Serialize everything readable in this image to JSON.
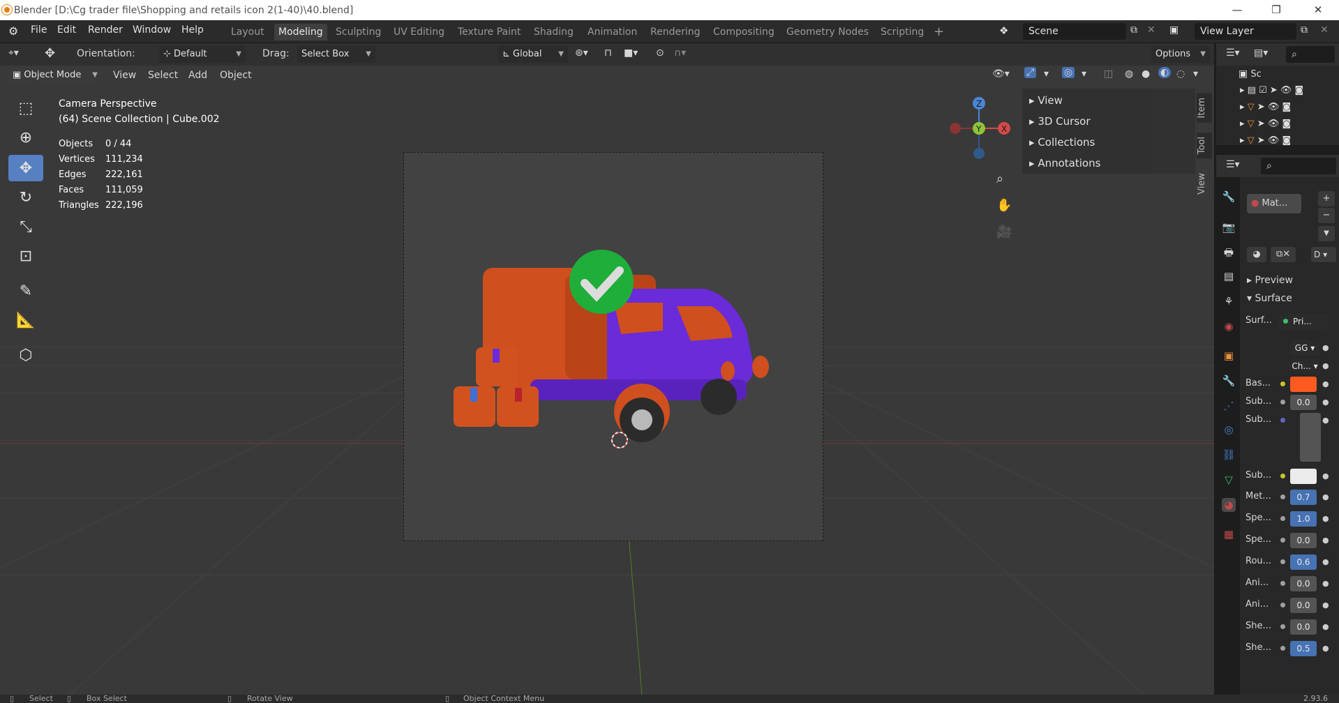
{
  "window": {
    "title": "Blender [D:\\Cg trader file\\Shopping and retails icon 2(1-40)\\40.blend]",
    "minimize": "—",
    "maximize": "❐",
    "close": "✕"
  },
  "menus": [
    "File",
    "Edit",
    "Render",
    "Window",
    "Help"
  ],
  "workspaces": [
    "Layout",
    "Modeling",
    "Sculpting",
    "UV Editing",
    "Texture Paint",
    "Shading",
    "Animation",
    "Rendering",
    "Compositing",
    "Geometry Nodes",
    "Scripting"
  ],
  "active_workspace": "Modeling",
  "scene": {
    "name": "Scene",
    "view_layer": "View Layer"
  },
  "header": {
    "orientation_label": "Orientation:",
    "orientation_value": "Default",
    "drag_label": "Drag:",
    "drag_value": "Select Box",
    "transform_value": "Global",
    "options": "Options"
  },
  "viewport_header": {
    "mode": "Object Mode",
    "view": "View",
    "select": "Select",
    "add": "Add",
    "object": "Object"
  },
  "overlay": {
    "camera": "Camera Perspective",
    "collection": "(64) Scene Collection | Cube.002"
  },
  "stats": [
    {
      "k": "Objects",
      "v": "0 / 44"
    },
    {
      "k": "Vertices",
      "v": "111,234"
    },
    {
      "k": "Edges",
      "v": "222,161"
    },
    {
      "k": "Faces",
      "v": "111,059"
    },
    {
      "k": "Triangles",
      "v": "222,196"
    }
  ],
  "npanel": [
    "View",
    "3D Cursor",
    "Collections",
    "Annotations"
  ],
  "ntabs": [
    "Item",
    "Tool",
    "View"
  ],
  "gizmo": {
    "z": "Z",
    "y": "Y",
    "x": "X"
  },
  "outliner": {
    "root": "Sc"
  },
  "props": {
    "material": "Mat...",
    "preview": "Preview",
    "surface": "Surface",
    "d_drop": "D",
    "rows": [
      {
        "label": "Surf...",
        "value": "Pri..."
      },
      {
        "label": "",
        "value": "GG"
      },
      {
        "label": "",
        "value": "Ch..."
      },
      {
        "label": "Bas...",
        "value": ""
      },
      {
        "label": "Sub...",
        "value": "0.0"
      },
      {
        "label": "Sub...",
        "value": ""
      },
      {
        "label": "Sub...",
        "value": ""
      },
      {
        "label": "Met...",
        "value": "0.7"
      },
      {
        "label": "Spe...",
        "value": "1.0"
      },
      {
        "label": "Spe...",
        "value": "0.0"
      },
      {
        "label": "Rou...",
        "value": "0.6"
      },
      {
        "label": "Ani...",
        "value": "0.0"
      },
      {
        "label": "Ani...",
        "value": "0.0"
      },
      {
        "label": "She...",
        "value": "0.0"
      },
      {
        "label": "She...",
        "value": "0.5"
      }
    ]
  },
  "statusbar": {
    "select": "Select",
    "box_select": "Box Select",
    "rotate": "Rotate View",
    "context": "Object Context Menu",
    "version": "2.93.6"
  },
  "colors": {
    "accent": "#4772b3",
    "base_color": "#ff5a1f",
    "truck_body": "#d2521f",
    "truck_cab": "#6a2bd8",
    "check": "#1fae3a"
  }
}
